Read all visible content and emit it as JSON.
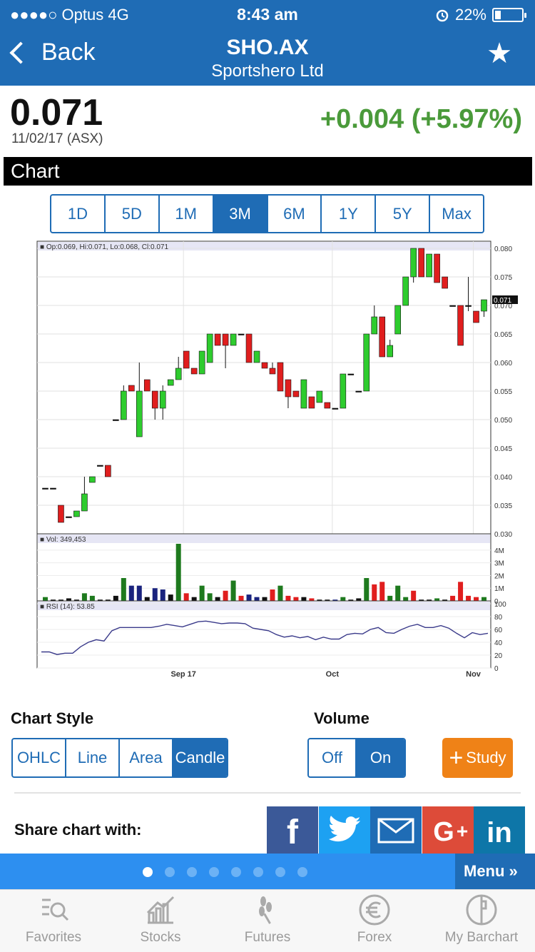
{
  "status": {
    "carrier": "●●●●○ Optus   4G",
    "time": "8:43 am",
    "battery": "22%"
  },
  "header": {
    "back_label": "Back",
    "title": "SHO.AX",
    "subtitle": "Sportshero Ltd"
  },
  "quote": {
    "price": "0.071",
    "date": "11/02/17 (ASX)",
    "change": "+0.004  (+5.97%)",
    "change_color": "#4a9a3a"
  },
  "chart_section_title": "Chart",
  "ranges": [
    "1D",
    "5D",
    "1M",
    "3M",
    "6M",
    "1Y",
    "5Y",
    "Max"
  ],
  "active_range": "3M",
  "chart_style": {
    "label": "Chart Style",
    "options": [
      "OHLC",
      "Line",
      "Area",
      "Candle"
    ],
    "selected": "Candle"
  },
  "volume": {
    "label": "Volume",
    "options": [
      "Off",
      "On"
    ],
    "selected": "On"
  },
  "study_label": "Study",
  "share": {
    "label": "Share chart with:",
    "targets": [
      "facebook-icon",
      "twitter-icon",
      "email-icon",
      "google-plus-icon",
      "linkedin-icon"
    ],
    "colors": [
      "#3b5998",
      "#1da1f2",
      "#1f6cb5",
      "#dd4b39",
      "#0e76a8"
    ]
  },
  "pager": {
    "pages": 8,
    "current": 0,
    "menu_label": "Menu »"
  },
  "tabs": [
    {
      "label": "Favorites",
      "icon": "favorites-icon"
    },
    {
      "label": "Stocks",
      "icon": "stocks-icon"
    },
    {
      "label": "Futures",
      "icon": "futures-icon"
    },
    {
      "label": "Forex",
      "icon": "forex-icon"
    },
    {
      "label": "My Barchart",
      "icon": "my-barchart-icon"
    }
  ],
  "chart_data": {
    "type": "candlestick",
    "legend": "Op:0.069, Hi:0.071, Lo:0.068, Cl:0.071",
    "price_axis": {
      "min": 0.03,
      "max": 0.08,
      "ticks": [
        "0.080",
        "0.075",
        "0.070",
        "0.065",
        "0.060",
        "0.055",
        "0.050",
        "0.045",
        "0.040",
        "0.035",
        "0.030"
      ],
      "last_label": "0.071"
    },
    "x_labels": [
      "Sep 17",
      "Oct",
      "Nov"
    ],
    "candles": [
      [
        0.038,
        0.038,
        0.038,
        0.038
      ],
      [
        0.038,
        0.038,
        0.038,
        0.038
      ],
      [
        0.035,
        0.035,
        0.032,
        0.032
      ],
      [
        0.033,
        0.033,
        0.033,
        0.033
      ],
      [
        0.033,
        0.034,
        0.033,
        0.034
      ],
      [
        0.034,
        0.04,
        0.034,
        0.037
      ],
      [
        0.039,
        0.04,
        0.039,
        0.04
      ],
      [
        0.042,
        0.042,
        0.042,
        0.042
      ],
      [
        0.042,
        0.042,
        0.04,
        0.04
      ],
      [
        0.05,
        0.05,
        0.05,
        0.05
      ],
      [
        0.05,
        0.056,
        0.05,
        0.055
      ],
      [
        0.056,
        0.056,
        0.055,
        0.055
      ],
      [
        0.047,
        0.06,
        0.047,
        0.055
      ],
      [
        0.057,
        0.057,
        0.055,
        0.055
      ],
      [
        0.055,
        0.055,
        0.05,
        0.052
      ],
      [
        0.052,
        0.056,
        0.05,
        0.055
      ],
      [
        0.056,
        0.057,
        0.056,
        0.057
      ],
      [
        0.057,
        0.061,
        0.057,
        0.059
      ],
      [
        0.062,
        0.062,
        0.059,
        0.059
      ],
      [
        0.059,
        0.059,
        0.058,
        0.058
      ],
      [
        0.058,
        0.062,
        0.058,
        0.062
      ],
      [
        0.06,
        0.065,
        0.06,
        0.065
      ],
      [
        0.065,
        0.065,
        0.063,
        0.063
      ],
      [
        0.065,
        0.065,
        0.059,
        0.063
      ],
      [
        0.063,
        0.065,
        0.063,
        0.065
      ],
      [
        0.065,
        0.065,
        0.065,
        0.065
      ],
      [
        0.065,
        0.065,
        0.06,
        0.06
      ],
      [
        0.06,
        0.062,
        0.06,
        0.062
      ],
      [
        0.06,
        0.06,
        0.059,
        0.059
      ],
      [
        0.059,
        0.06,
        0.058,
        0.058
      ],
      [
        0.06,
        0.06,
        0.055,
        0.055
      ],
      [
        0.057,
        0.057,
        0.052,
        0.054
      ],
      [
        0.055,
        0.055,
        0.054,
        0.054
      ],
      [
        0.052,
        0.057,
        0.052,
        0.057
      ],
      [
        0.054,
        0.054,
        0.052,
        0.052
      ],
      [
        0.053,
        0.055,
        0.053,
        0.055
      ],
      [
        0.053,
        0.053,
        0.052,
        0.052
      ],
      [
        0.052,
        0.052,
        0.052,
        0.052
      ],
      [
        0.052,
        0.058,
        0.052,
        0.058
      ],
      [
        0.058,
        0.058,
        0.058,
        0.058
      ],
      [
        0.055,
        0.055,
        0.055,
        0.055
      ],
      [
        0.055,
        0.065,
        0.055,
        0.065
      ],
      [
        0.065,
        0.07,
        0.065,
        0.068
      ],
      [
        0.068,
        0.068,
        0.061,
        0.061
      ],
      [
        0.061,
        0.064,
        0.061,
        0.063
      ],
      [
        0.065,
        0.07,
        0.065,
        0.07
      ],
      [
        0.07,
        0.075,
        0.07,
        0.075
      ],
      [
        0.075,
        0.08,
        0.074,
        0.08
      ],
      [
        0.08,
        0.08,
        0.075,
        0.075
      ],
      [
        0.075,
        0.079,
        0.075,
        0.079
      ],
      [
        0.079,
        0.079,
        0.074,
        0.074
      ],
      [
        0.075,
        0.075,
        0.073,
        0.073
      ],
      [
        0.07,
        0.07,
        0.07,
        0.07
      ],
      [
        0.07,
        0.07,
        0.063,
        0.063
      ],
      [
        0.07,
        0.075,
        0.069,
        0.07
      ],
      [
        0.069,
        0.069,
        0.067,
        0.067
      ],
      [
        0.069,
        0.071,
        0.068,
        0.071
      ]
    ],
    "volume": {
      "legend": "Vol: 349,453",
      "ticks": [
        "4M",
        "3M",
        "2M",
        "1M",
        "0"
      ],
      "max": 4.5,
      "values": [
        0.3,
        0.1,
        0.1,
        0.2,
        0.1,
        0.6,
        0.4,
        0.1,
        0.1,
        0.4,
        1.8,
        1.2,
        1.2,
        0.3,
        1.0,
        0.9,
        0.5,
        4.5,
        0.6,
        0.3,
        1.2,
        0.6,
        0.3,
        0.8,
        1.6,
        0.4,
        0.5,
        0.3,
        0.3,
        0.9,
        1.2,
        0.4,
        0.3,
        0.3,
        0.2,
        0.1,
        0.1,
        0.1,
        0.3,
        0.1,
        0.2,
        1.8,
        1.3,
        1.5,
        0.4,
        1.2,
        0.3,
        0.8,
        0.1,
        0.1,
        0.2,
        0.1,
        0.4,
        1.5,
        0.4,
        0.3,
        0.3
      ],
      "colors": [
        "g",
        "k",
        "k",
        "k",
        "k",
        "g",
        "g",
        "k",
        "k",
        "k",
        "g",
        "b",
        "b",
        "k",
        "b",
        "b",
        "k",
        "g",
        "r",
        "k",
        "g",
        "g",
        "k",
        "r",
        "g",
        "r",
        "b",
        "b",
        "k",
        "r",
        "g",
        "r",
        "r",
        "k",
        "r",
        "k",
        "k",
        "b",
        "g",
        "k",
        "k",
        "g",
        "r",
        "r",
        "g",
        "g",
        "g",
        "r",
        "k",
        "k",
        "g",
        "k",
        "r",
        "r",
        "r",
        "r",
        "g"
      ]
    },
    "rsi": {
      "legend": "RSI (14): 53.85",
      "ticks": [
        "100",
        "80",
        "60",
        "40",
        "20",
        "0"
      ],
      "values": [
        25,
        25,
        21,
        23,
        23,
        33,
        40,
        44,
        42,
        58,
        63,
        63,
        63,
        63,
        63,
        65,
        68,
        66,
        64,
        68,
        72,
        73,
        71,
        69,
        70,
        70,
        69,
        62,
        60,
        58,
        52,
        48,
        50,
        47,
        49,
        44,
        48,
        45,
        45,
        52,
        54,
        53,
        60,
        63,
        55,
        54,
        60,
        65,
        68,
        63,
        63,
        66,
        62,
        54,
        47,
        55,
        52,
        54
      ]
    }
  }
}
